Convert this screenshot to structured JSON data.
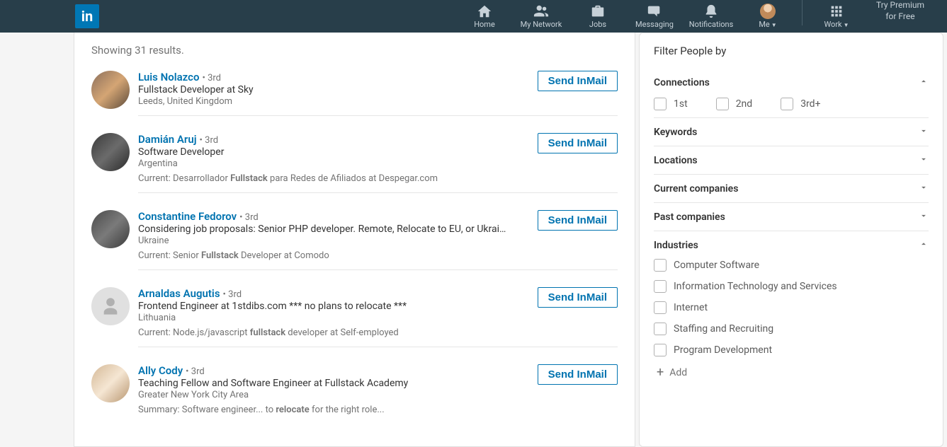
{
  "header": {
    "logo_text": "in",
    "nav": {
      "home": "Home",
      "my_network": "My Network",
      "jobs": "Jobs",
      "messaging": "Messaging",
      "notifications": "Notifications",
      "me": "Me",
      "work": "Work"
    },
    "premium_line1": "Try Premium",
    "premium_line2": "for Free"
  },
  "results_header": "Showing 31 results.",
  "action_label": "Send InMail",
  "results": [
    {
      "name": "Luis Nolazco",
      "degree": "• 3rd",
      "headline": "Fullstack Developer at Sky",
      "location": "Leeds, United Kingdom",
      "avatar_class": "p1"
    },
    {
      "name": "Damián Aruj",
      "degree": "• 3rd",
      "headline": "Software Developer",
      "location": "Argentina",
      "extra_prefix": "Current: Desarrollador ",
      "extra_bold": "Fullstack",
      "extra_suffix": " para Redes de Afiliados at Despegar.com",
      "avatar_class": "p2"
    },
    {
      "name": "Constantine Fedorov",
      "degree": "• 3rd",
      "headline": "Considering job proposals: Senior PHP developer. Remote, Relocate to EU, or Ukrai…",
      "location": "Ukraine",
      "extra_prefix": "Current: Senior ",
      "extra_bold": "Fullstack",
      "extra_suffix": " Developer at Comodo",
      "avatar_class": "p3"
    },
    {
      "name": "Arnaldas Augutis",
      "degree": "• 3rd",
      "headline": "Frontend Engineer at 1stdibs.com *** no plans to relocate ***",
      "location": "Lithuania",
      "extra_prefix": "Current: Node.js/javascript ",
      "extra_bold": "fullstack",
      "extra_suffix": " developer at Self-employed",
      "avatar_class": "ph"
    },
    {
      "name": "Ally Cody",
      "degree": "• 3rd",
      "headline": "Teaching Fellow and Software Engineer at Fullstack Academy",
      "location": "Greater New York City Area",
      "extra_prefix": "Summary: Software engineer... to ",
      "extra_bold": "relocate",
      "extra_suffix": " for the right role...",
      "avatar_class": "p5"
    }
  ],
  "sidebar": {
    "title": "Filter People by",
    "connections": {
      "label": "Connections",
      "opts": [
        "1st",
        "2nd",
        "3rd+"
      ]
    },
    "keywords": "Keywords",
    "locations": "Locations",
    "current_companies": "Current companies",
    "past_companies": "Past companies",
    "industries": {
      "label": "Industries",
      "opts": [
        "Computer Software",
        "Information Technology and Services",
        "Internet",
        "Staffing and Recruiting",
        "Program Development"
      ],
      "add": "Add"
    }
  }
}
